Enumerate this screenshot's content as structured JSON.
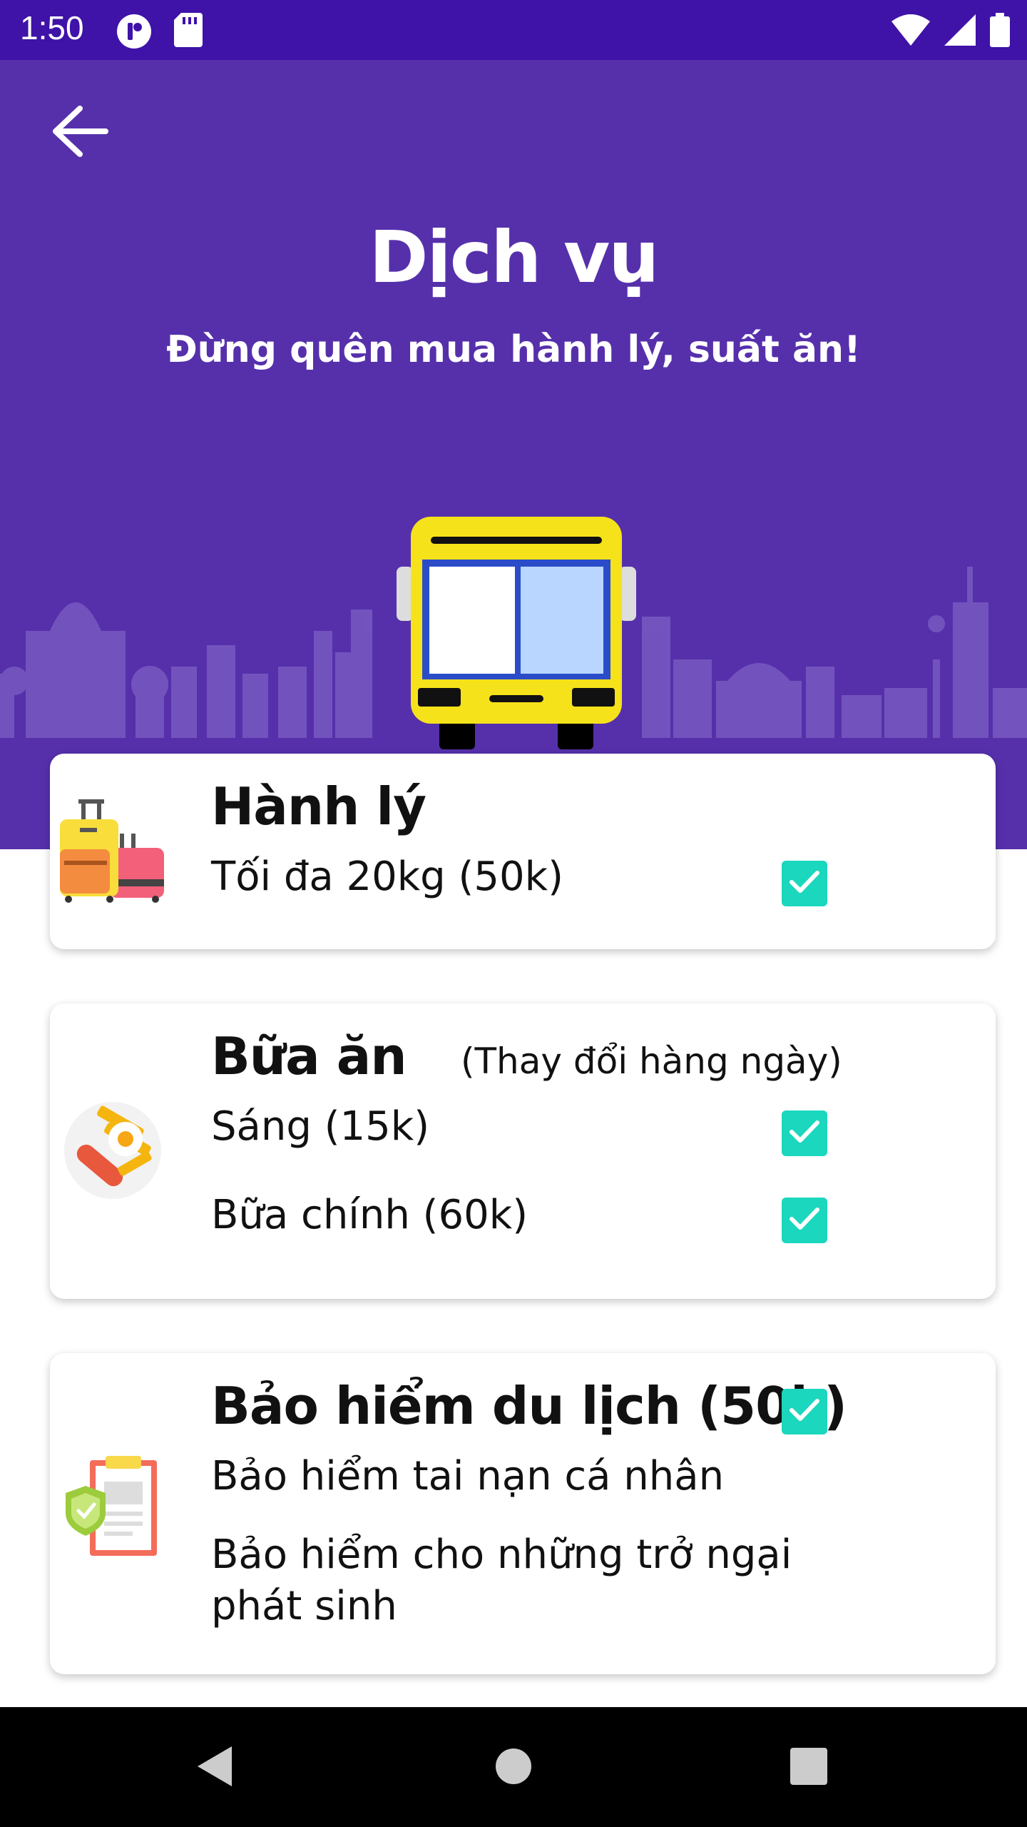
{
  "status_bar": {
    "time": "1:50",
    "icons_left": [
      "app-icon",
      "sd-card-icon"
    ],
    "icons_right": [
      "wifi-icon",
      "signal-icon",
      "battery-icon"
    ]
  },
  "header": {
    "back_icon": "arrow-left-icon",
    "title": "Dịch vụ",
    "subtitle": "Đừng quên mua hành lý, suất ăn!"
  },
  "colors": {
    "status_bar": "#3f12a8",
    "hero": "#5630ab",
    "checkbox": "#1ad7be",
    "nav_bar": "#000000"
  },
  "luggage": {
    "title": "Hành lý",
    "option": "Tối đa 20kg (50k)",
    "checked": true
  },
  "meals": {
    "title": "Bữa ăn",
    "note": "(Thay đổi hàng ngày)",
    "breakfast": "Sáng (15k)",
    "breakfast_checked": true,
    "main_meal": "Bữa chính (60k)",
    "main_meal_checked": true
  },
  "insurance": {
    "title": "Bảo hiểm du lịch (50k)",
    "checked": true,
    "line1": "Bảo hiểm tai nạn cá nhân",
    "line2": "Bảo hiểm cho những trở ngại",
    "line3": "phát sinh"
  },
  "nav": [
    "back-triangle-icon",
    "home-circle-icon",
    "recents-square-icon"
  ]
}
